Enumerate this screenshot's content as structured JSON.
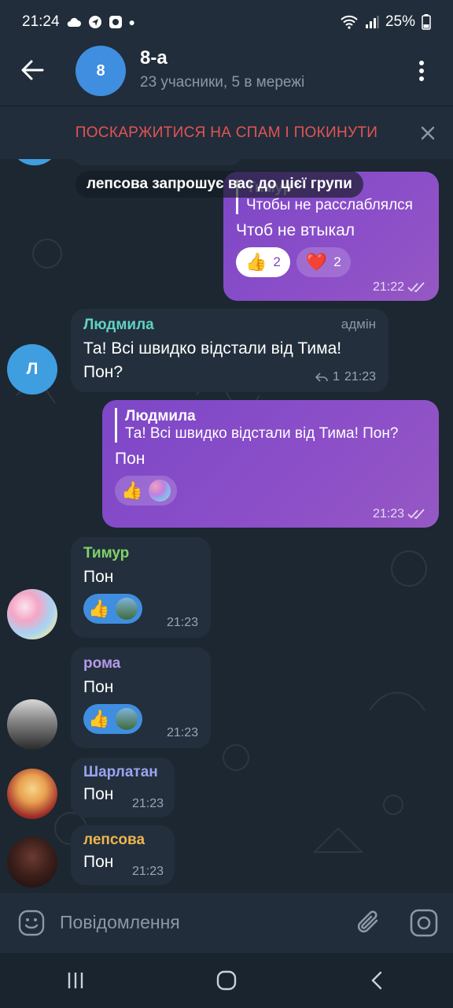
{
  "status_bar": {
    "time": "21:24",
    "battery": "25%",
    "icons": [
      "cloud-icon",
      "location-icon",
      "app-icon",
      "dot-icon",
      "wifi-icon",
      "signal-icon",
      "battery-icon"
    ]
  },
  "header": {
    "avatar_letter": "8",
    "avatar_color": "#3f8ee0",
    "title": "8-а",
    "subtitle": "23 учасники, 5 в мережі"
  },
  "spam_bar": {
    "label": "ПОСКАРЖИТИСЯ НА СПАМ І ПОКИНУТИ",
    "color": "#e65353"
  },
  "service_message": "лепсова запрошує вас до цієї групи",
  "messages": [
    {
      "direction": "out",
      "reply_to": {
        "name": "Тимур",
        "text": "Чтобы не расслаблялся"
      },
      "text": "Чтоб не втыкал",
      "reactions": [
        {
          "emoji": "👍",
          "count": "2"
        },
        {
          "emoji": "❤️",
          "count": "2"
        }
      ],
      "time": "21:22",
      "read": true
    },
    {
      "direction": "in",
      "sender": "Людмила",
      "sender_color": "#5fd3c4",
      "role": "адмін",
      "avatar_letter": "Л",
      "avatar_color": "#3f9ee0",
      "text_line1": "Та! Всі швидко відстали від Тима!",
      "text_line2": "Пон?",
      "replies": "1",
      "time": "21:23"
    },
    {
      "direction": "out",
      "reply_to": {
        "name": "Людмила",
        "text": "Та! Всі швидко відстали від Тима! Пон?"
      },
      "text": "Пон",
      "time": "21:23",
      "read": true
    },
    {
      "direction": "in",
      "sender": "Тимур",
      "sender_color": "#7fd36a",
      "text": "Пон",
      "time": "21:23"
    },
    {
      "direction": "in",
      "sender": "рома",
      "sender_color": "#b39ae8",
      "text": "Пон",
      "time": "21:23"
    },
    {
      "direction": "in",
      "sender": "Шарлатан",
      "sender_color": "#9aa4f0",
      "text": "Пон",
      "time": "21:23"
    },
    {
      "direction": "in",
      "sender": "лепсова",
      "sender_color": "#f0b64c",
      "text": "Пон",
      "time": "21:23"
    }
  ],
  "input": {
    "placeholder": "Повідомлення"
  }
}
